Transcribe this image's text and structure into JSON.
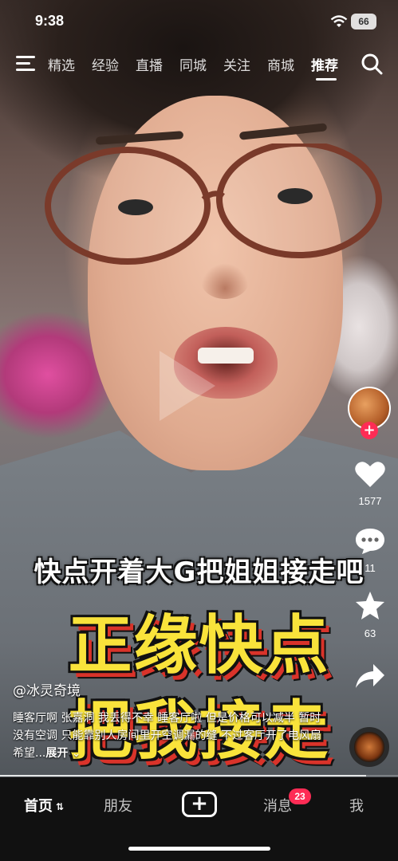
{
  "status_bar": {
    "time": "9:38",
    "battery": "66"
  },
  "top_nav": {
    "tabs": [
      "精选",
      "经验",
      "直播",
      "同城",
      "关注",
      "商城",
      "推荐"
    ],
    "active_tab": "推荐"
  },
  "video": {
    "caption_small": "快点开着大G把姐姐接走吧",
    "caption_big_line1": "正缘快点",
    "caption_big_line2": "把我接走",
    "author": "@冰灵奇境",
    "description": "睡客厅啊 张嘉洞 我丢得不幸 睡客厅啦 但是价格可以减半 暂时没有空调 只能靠别人房间里开空调漏的缝 不过客厅开了电风扇 希望...",
    "expand_label": "展开",
    "progress": 0.92
  },
  "right_rail": {
    "likes": "1577",
    "comments": "11",
    "favorites": "63"
  },
  "bottom_nav": {
    "home": "首页",
    "friends": "朋友",
    "add": "+",
    "messages": "消息",
    "messages_badge": "23",
    "me": "我"
  },
  "colors": {
    "accent": "#fe2c55",
    "caption_yellow": "#f9e33b",
    "caption_shadow": "#d9332a"
  }
}
